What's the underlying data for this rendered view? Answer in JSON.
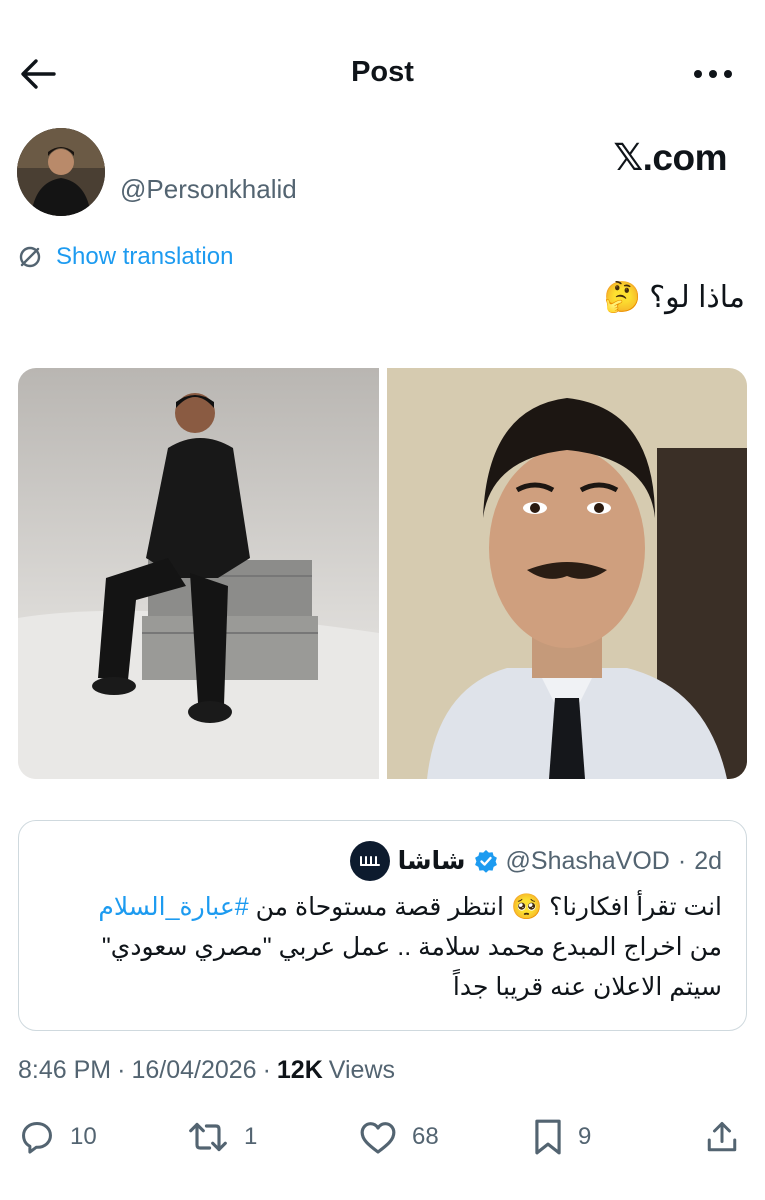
{
  "header": {
    "title": "Post"
  },
  "author": {
    "handle": "@Personkhalid"
  },
  "brand": "𝕏.com",
  "translation": {
    "label": "Show translation"
  },
  "post": {
    "text": "ماذا لو؟",
    "emoji": "🤔"
  },
  "quote": {
    "name": "شاشا",
    "handle": "@ShashaVOD",
    "separator": "·",
    "time": "2d",
    "line1_pre": "انت تقرأ افكارنا؟",
    "line1_emoji": "🥺",
    "line1_mid": "انتظر قصة مستوحاة من",
    "hashtag": "#عبارة_السلام",
    "line2": "من اخراج المبدع محمد سلامة .. عمل عربي \"مصري سعودي\"",
    "line3": "سيتم الاعلان عنه قريبا جداً"
  },
  "meta": {
    "time": "8:46 PM",
    "sep1": "·",
    "date": "16/04/2026",
    "sep2": "·",
    "views_count": "12K",
    "views_label": "Views"
  },
  "actions": {
    "replies": "10",
    "reposts": "1",
    "likes": "68",
    "bookmarks": "9"
  },
  "icons": {
    "back": "back-arrow-icon",
    "more": "more-dots-icon",
    "translate": "translate-icon",
    "verified": "verified-badge-icon",
    "reply": "reply-icon",
    "repost": "repost-icon",
    "like": "like-icon",
    "bookmark": "bookmark-icon",
    "share": "share-icon"
  },
  "colors": {
    "accent": "#1d9bf0",
    "secondary_text": "#536471",
    "border": "#cfd9de"
  }
}
